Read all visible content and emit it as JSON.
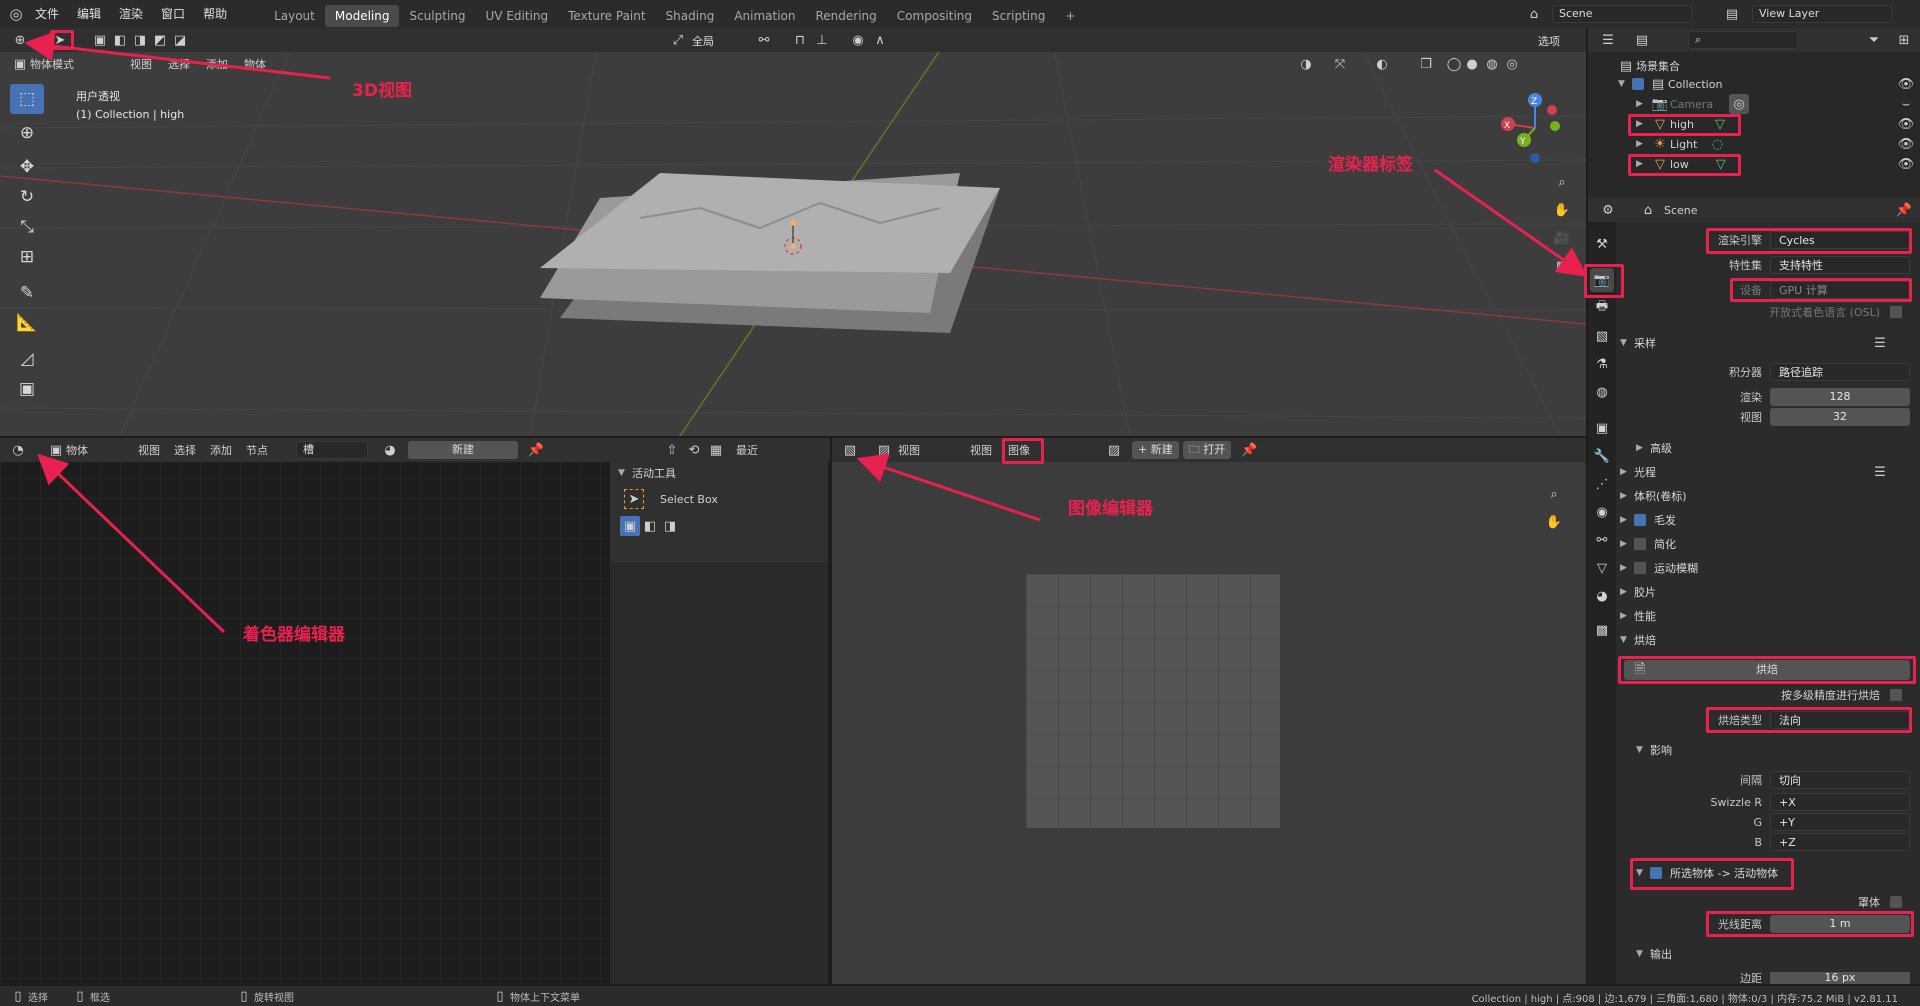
{
  "topbar": {
    "menus": [
      "文件",
      "编辑",
      "渲染",
      "窗口",
      "帮助"
    ],
    "workspaces": [
      "Layout",
      "Modeling",
      "Sculpting",
      "UV Editing",
      "Texture Paint",
      "Shading",
      "Animation",
      "Rendering",
      "Compositing",
      "Scripting"
    ],
    "active_workspace": "Modeling",
    "scene_name": "Scene",
    "view_layer": "View Layer"
  },
  "viewport": {
    "orient_label": "全局",
    "options_label": "选项",
    "mode_label": "物体模式",
    "menus": [
      "视图",
      "选择",
      "添加",
      "物体"
    ],
    "overlay_title": "用户透视",
    "overlay_subtitle": "(1) Collection | high"
  },
  "shader_editor": {
    "type_label": "物体",
    "menus": [
      "视图",
      "选择",
      "添加",
      "节点"
    ],
    "slot_label": "槽",
    "new_label": "新建",
    "recent_label": "最近",
    "tool_panel_title": "活动工具",
    "tool_name": "Select Box"
  },
  "image_editor": {
    "view_label": "视图",
    "menus": [
      "视图",
      "图像"
    ],
    "new_label": "新建",
    "open_label": "打开"
  },
  "outliner": {
    "title": "场景集合",
    "collection": "Collection",
    "items": [
      "Camera",
      "high",
      "Light",
      "low"
    ]
  },
  "properties": {
    "scene_name": "Scene",
    "render_engine_label": "渲染引擎",
    "render_engine": "Cycles",
    "feature_set_label": "特性集",
    "feature_set": "支持特性",
    "device_label": "设备",
    "device": "GPU 计算",
    "osl_label": "开放式着色语言 (OSL)",
    "sampling_label": "采样",
    "integrator_label": "积分器",
    "integrator": "路径追踪",
    "render_label": "渲染",
    "render_samples": "128",
    "viewport_label": "视图",
    "viewport_samples": "32",
    "advanced_label": "高级",
    "light_paths_label": "光程",
    "volumes_label": "体积(卷标)",
    "hair_label": "毛发",
    "simplify_label": "简化",
    "motion_blur_label": "运动模糊",
    "film_label": "胶片",
    "performance_label": "性能",
    "bake_label": "烘焙",
    "bake_button": "烘焙",
    "multires_label": "按多级精度进行烘焙",
    "bake_type_label": "烘焙类型",
    "bake_type": "法向",
    "influence_label": "影响",
    "space_label": "间隔",
    "space_value": "切向",
    "swizzle_r_label": "Swizzle R",
    "swizzle_r": "+X",
    "swizzle_g_label": "G",
    "swizzle_g": "+Y",
    "swizzle_b_label": "B",
    "swizzle_b": "+Z",
    "selected_to_active_label": "所选物体 -> 活动物体",
    "cage_label": "罩体",
    "ray_distance_label": "光线距离",
    "ray_distance": "1 m",
    "output_label": "输出",
    "margin_label": "边距",
    "margin_value": "16 px"
  },
  "annotations": {
    "view3d": "3D视图",
    "render_tab": "渲染器标签",
    "shader_editor": "着色器编辑器",
    "image_editor": "图像编辑器"
  },
  "statusbar": {
    "select": "选择",
    "box_select": "框选",
    "rotate": "旋转视图",
    "context_menu": "物体上下文菜单",
    "stats": "Collection | high | 点:908 | 边:1,679 | 三角面:1,680 | 物体:0/3 | 内存:75.2 MiB | v2.81.11"
  },
  "colors": {
    "accent": "#e8214f",
    "blender_blue": "#4772b3",
    "header": "#303030",
    "viewport_bg": "#3d3d3d"
  }
}
